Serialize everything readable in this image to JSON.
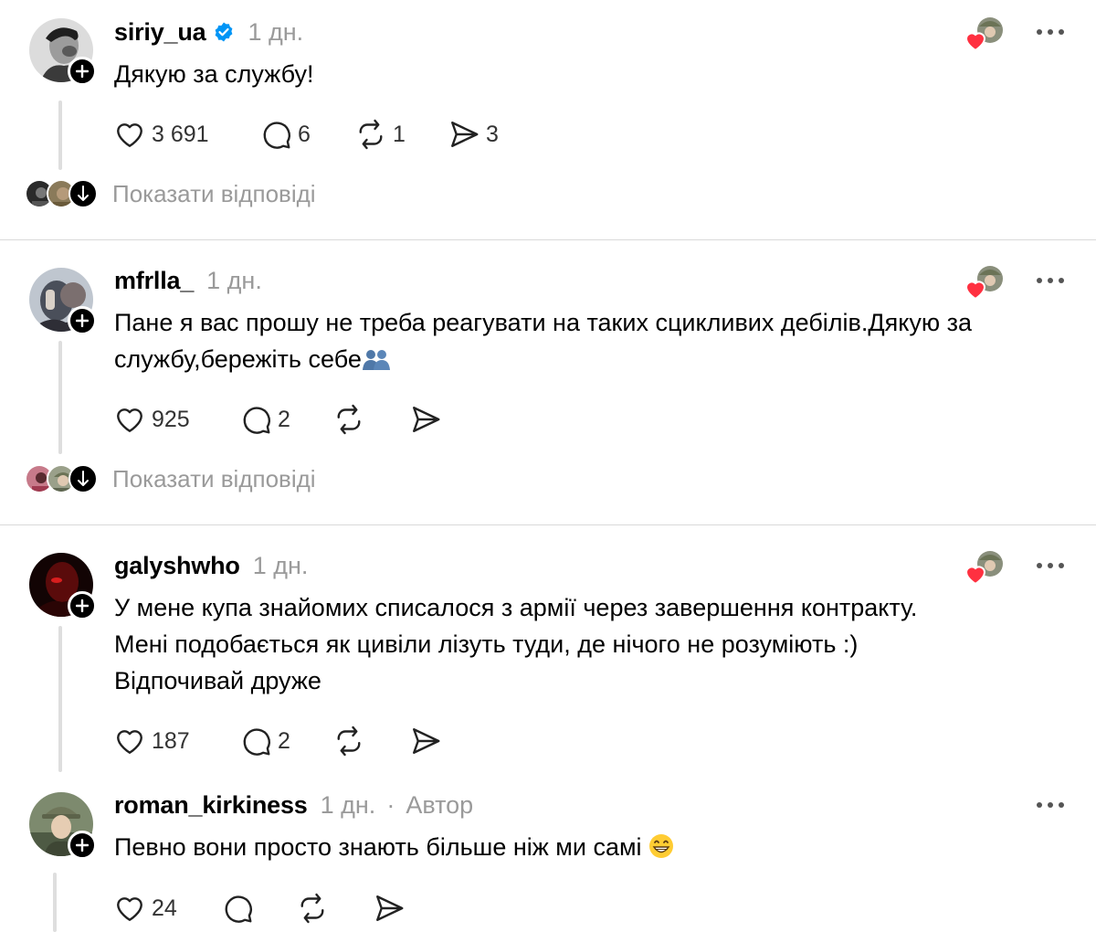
{
  "posts": [
    {
      "username": "siriy_ua",
      "time": "1 дн.",
      "verified": true,
      "text": "Дякую за службу!",
      "likes": "3 691",
      "comments": "6",
      "reposts": "1",
      "shares": "3",
      "show_replies": "Показати відповіді"
    },
    {
      "username": "mfrlla_",
      "time": "1 дн.",
      "text_line1": "Пане я вас прошу не треба реагувати на таких сцикливих дебілів.Дякую за",
      "text_line2": "службу,бережіть себе",
      "likes": "925",
      "comments": "2",
      "show_replies": "Показати відповіді"
    },
    {
      "username": "galyshwho",
      "time": "1 дн.",
      "text_line1": "У мене купа знайомих списалося з армії через завершення контракту.",
      "text_line2": "Мені подобається як цивіли лізуть туди, де нічого не розуміють :)",
      "text_line3": "Відпочивай друже",
      "likes": "187",
      "comments": "2"
    },
    {
      "username": "roman_kirkiness",
      "time": "1 дн.",
      "separator": "·",
      "author_label": "Автор",
      "text": "Певно вони просто знають більше ніж ми самі",
      "likes": "24"
    }
  ],
  "icons": {
    "heart": "heart-icon",
    "comment": "comment-icon",
    "repost": "repost-icon",
    "share": "share-icon",
    "more": "more-icon",
    "verified": "verified-badge-icon",
    "follow": "follow-plus-icon"
  },
  "colors": {
    "accent_like": "#ff3040",
    "verified": "#0095f6",
    "muted_text": "#9a9a9a"
  }
}
